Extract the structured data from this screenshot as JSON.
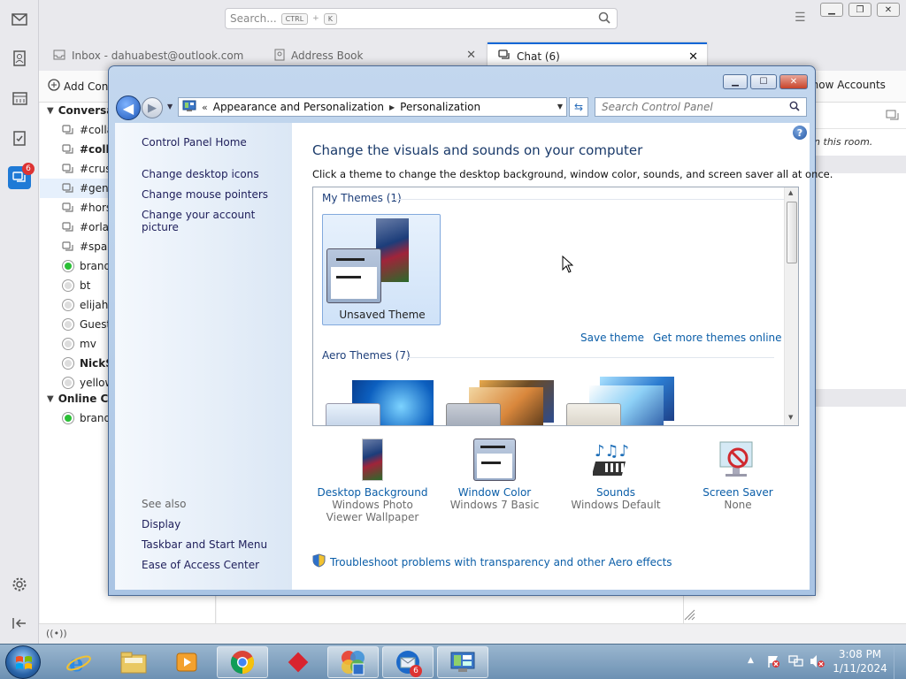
{
  "thunderbird": {
    "search_placeholder": "Search...",
    "search_kbd_ctrl": "CTRL",
    "search_kbd_plus": "+",
    "search_kbd_k": "K",
    "chat_badge": "6",
    "tabs": [
      {
        "label": "Inbox - dahuabest@outlook.com"
      },
      {
        "label": "Address Book"
      },
      {
        "label": "Chat (6)"
      }
    ],
    "toolbar": {
      "add_contact": "Add Contact",
      "show_accounts": "Show Accounts"
    },
    "conversations_header": "Conversations",
    "conversations": [
      {
        "label": "#collab",
        "bold": false
      },
      {
        "label": "#collab",
        "bold": true
      },
      {
        "label": "#crust",
        "bold": false
      },
      {
        "label": "#general",
        "bold": false,
        "selected": true
      },
      {
        "label": "#horse",
        "bold": false
      },
      {
        "label": "#orlando",
        "bold": false
      },
      {
        "label": "#spam",
        "bold": false
      },
      {
        "label": "brandon",
        "bold": false,
        "online": true
      },
      {
        "label": "bt",
        "bold": false
      },
      {
        "label": "elijah",
        "bold": false
      },
      {
        "label": "Guest",
        "bold": false
      },
      {
        "label": "mv",
        "bold": false
      },
      {
        "label": "NickServ",
        "bold": true
      },
      {
        "label": "yellow",
        "bold": false
      }
    ],
    "online_header": "Online Contacts",
    "online": [
      {
        "label": "brandon"
      }
    ],
    "chat_room_note": "in this room."
  },
  "control_panel": {
    "breadcrumb": [
      "Appearance and Personalization",
      "Personalization"
    ],
    "search_placeholder": "Search Control Panel",
    "left": {
      "home": "Control Panel Home",
      "links": [
        "Change desktop icons",
        "Change mouse pointers",
        "Change your account picture"
      ],
      "see_also": "See also",
      "see_also_links": [
        "Display",
        "Taskbar and Start Menu",
        "Ease of Access Center"
      ]
    },
    "heading": "Change the visuals and sounds on your computer",
    "subheading": "Click a theme to change the desktop background, window color, sounds, and screen saver all at once.",
    "my_themes": "My Themes (1)",
    "unsaved_theme": "Unsaved Theme",
    "save_theme": "Save theme",
    "more_themes": "Get more themes online",
    "aero_themes": "Aero Themes (7)",
    "bottom_items": [
      {
        "label": "Desktop Background",
        "sub": "Windows Photo Viewer Wallpaper"
      },
      {
        "label": "Window Color",
        "sub": "Windows 7 Basic"
      },
      {
        "label": "Sounds",
        "sub": "Windows Default"
      },
      {
        "label": "Screen Saver",
        "sub": "None"
      }
    ],
    "troubleshoot": "Troubleshoot problems with transparency and other Aero effects"
  },
  "taskbar": {
    "time": "3:08 PM",
    "date": "1/11/2024",
    "thunderbird_badge": "6"
  },
  "colors": {
    "accent": "#0b66d6",
    "link": "#0b5ea8",
    "taskbar": "#7c9cbd"
  }
}
